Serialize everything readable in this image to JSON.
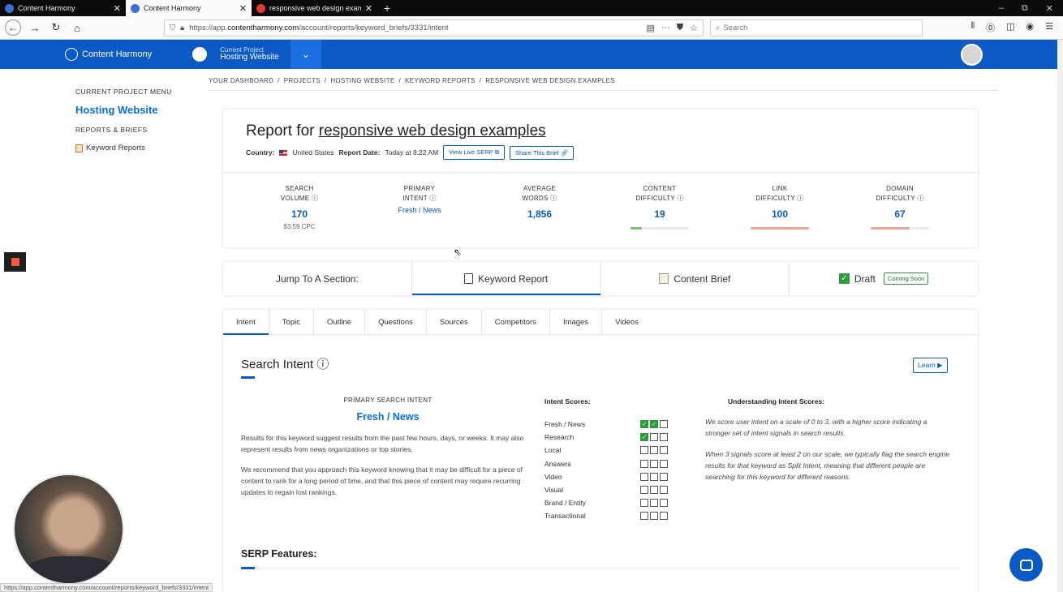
{
  "browser": {
    "tabs": [
      {
        "title": "Content Harmony",
        "active": false
      },
      {
        "title": "Content Harmony",
        "active": true
      },
      {
        "title": "responsive web design exampl…",
        "active": false
      }
    ],
    "new_tab": "+",
    "url_prefix": "https://app.",
    "url_domain": "contentharmony.com",
    "url_path": "/account/reports/keyword_briefs/3331/intent",
    "search_placeholder": "Search",
    "status_url": "https://app.contentharmony.com/account/reports/keyword_briefs/3331/intent"
  },
  "header": {
    "brand": "Content Harmony",
    "current_project_label": "Current Project",
    "current_project": "Hosting Website"
  },
  "sidebar": {
    "menu_label": "CURRENT PROJECT MENU",
    "project": "Hosting Website",
    "section_label": "REPORTS & BRIEFS",
    "link": "Keyword Reports"
  },
  "breadcrumb": [
    "YOUR DASHBOARD",
    "/",
    "PROJECTS",
    "/",
    "HOSTING WEBSITE",
    "/",
    "KEYWORD REPORTS",
    "/",
    "RESPONSIVE WEB DESIGN EXAMPLES"
  ],
  "report": {
    "title_prefix": "Report for ",
    "keyword": "responsive web design examples",
    "country_label": "Country:",
    "country": "United States",
    "date_label": "Report Date:",
    "date": "Today at 8:22 AM",
    "view_serp": "View Live SERP",
    "share": "Share This Brief",
    "metrics": [
      {
        "label1": "SEARCH",
        "label2": "VOLUME",
        "value": "170",
        "sub": "$3.59 CPC"
      },
      {
        "label1": "PRIMARY",
        "label2": "INTENT",
        "value": "Fresh / News",
        "sub": ""
      },
      {
        "label1": "AVERAGE",
        "label2": "WORDS",
        "value": "1,856",
        "sub": ""
      },
      {
        "label1": "CONTENT",
        "label2": "DIFFICULTY",
        "value": "19",
        "sub": "",
        "fill": 0.19,
        "color": "#6cc56a"
      },
      {
        "label1": "LINK",
        "label2": "DIFFICULTY",
        "value": "100",
        "sub": "",
        "fill": 1.0,
        "color": "#f2a195"
      },
      {
        "label1": "DOMAIN",
        "label2": "DIFFICULTY",
        "value": "67",
        "sub": "",
        "fill": 0.67,
        "color": "#f2a195"
      }
    ]
  },
  "sections": {
    "jump": "Jump To A Section:",
    "keyword_report": "Keyword Report",
    "content_brief": "Content Brief",
    "draft": "Draft",
    "coming_soon": "Coming Soon"
  },
  "subtabs": [
    "Intent",
    "Topic",
    "Outline",
    "Questions",
    "Sources",
    "Competitors",
    "Images",
    "Videos"
  ],
  "intent": {
    "title": "Search Intent",
    "learn": "Learn",
    "primary_label": "PRIMARY SEARCH INTENT",
    "primary_value": "Fresh / News",
    "para1": "Results for this keyword suggest results from the past few hours, days, or weeks. It may also represent results from news organizations or top stories.",
    "para2": "We recommend that you approach this keyword knowing that it may be difficult for a piece of content to rank for a long period of time, and that this piece of content may require recurring updates to regain lost rankings.",
    "scores_title": "Intent Scores:",
    "scores": [
      {
        "name": "Fresh / News",
        "score": 2
      },
      {
        "name": "Research",
        "score": 1
      },
      {
        "name": "Local",
        "score": 0
      },
      {
        "name": "Answers",
        "score": 0
      },
      {
        "name": "Video",
        "score": 0
      },
      {
        "name": "Visual",
        "score": 0
      },
      {
        "name": "Brand / Entity",
        "score": 0
      },
      {
        "name": "Transactional",
        "score": 0
      }
    ],
    "understanding_title": "Understanding Intent Scores:",
    "understanding_p1": "We score user intent on a scale of 0 to 3, with a higher score indicating a stronger set of intent signals in search results.",
    "understanding_p2": "When 3 signals score at least 2 on our scale, we typically flag the search engine results for that keyword as Split Intent, meaning that different people are searching for this keyword for different reasons."
  },
  "serp_title": "SERP Features:"
}
